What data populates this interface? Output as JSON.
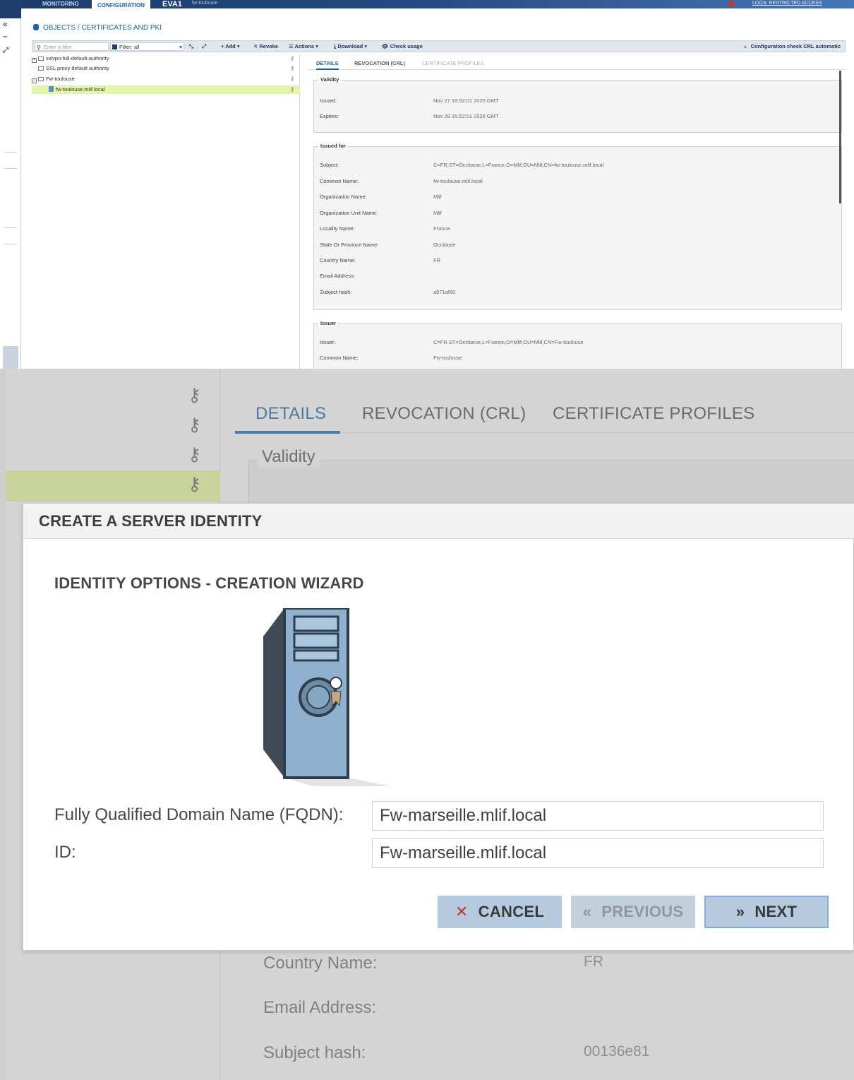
{
  "top": {
    "nav_tabs": [
      "MONITORING",
      "CONFIGURATION"
    ],
    "active_tab": "CONFIGURATION",
    "firewall_label": "EVA1",
    "firewall_name": "fw-toulouse",
    "logs_link": "LOGS: RESTRICTED ACCESS",
    "breadcrumb": "OBJECTS / CERTIFICATES AND PKI",
    "toolbar": {
      "filter_placeholder": "Enter a filter",
      "filter_select": "Filter: all",
      "add": "+ Add ▾",
      "revoke": "✕ Revoke",
      "actions": "☰ Actions ▾",
      "download": "⤓ Download ▾",
      "check_usage": "👁 Check usage",
      "warning": "Configuration check CRL automatic"
    },
    "tree": [
      {
        "label": "sslvpn-full-default-authority",
        "type": "ca-collapsed"
      },
      {
        "label": "SSL proxy default authority",
        "type": "ca"
      },
      {
        "label": "Fw-toulouse",
        "type": "ca-expanded"
      },
      {
        "label": "fw-toulouse.mlif.local",
        "type": "cert",
        "selected": true
      }
    ],
    "detail_tabs": [
      "DETAILS",
      "REVOCATION (CRL)",
      "CERTIFICATE PROFILES"
    ],
    "validity": {
      "legend": "Validity",
      "issued_label": "Issued:",
      "issued": "Nov 27 16:52:01 2025 GMT",
      "expires_label": "Expires:",
      "expires": "Nov 28 16:52:01 2026 GMT"
    },
    "issued_for": {
      "legend": "Issued for",
      "rows": [
        {
          "k": "Subject:",
          "v": "C=FR,ST=Occitanie,L=France,O=Mlif,OU=Mlif,CN=fw-toulouse.mlif.local"
        },
        {
          "k": "Common Name:",
          "v": "fw-toulouse.mlif.local"
        },
        {
          "k": "Organization Name:",
          "v": "Mlif"
        },
        {
          "k": "Organization Unit Name:",
          "v": "Mlif"
        },
        {
          "k": "Locality Name:",
          "v": "France"
        },
        {
          "k": "State Or Province Name:",
          "v": "Occitanie"
        },
        {
          "k": "Country Name:",
          "v": "FR"
        },
        {
          "k": "Email Address:",
          "v": ""
        },
        {
          "k": "Subject hash:",
          "v": "a971af60"
        }
      ]
    },
    "issuer": {
      "legend": "Issuer",
      "rows": [
        {
          "k": "Issuer:",
          "v": "C=FR,ST=Occitanie,L=France,O=Mlif,OU=Mlif,CN=Fw-toulouse"
        },
        {
          "k": "Common Name:",
          "v": "Fw-toulouse"
        }
      ]
    }
  },
  "zoom": {
    "detail_tabs": [
      "DETAILS",
      "REVOCATION (CRL)",
      "CERTIFICATE PROFILES"
    ],
    "validity_legend": "Validity",
    "bg_rows": [
      {
        "k": "Country Name:",
        "v": "FR"
      },
      {
        "k": "Email Address:",
        "v": ""
      },
      {
        "k": "Subject hash:",
        "v": "00136e81"
      }
    ],
    "modal": {
      "title": "CREATE A SERVER IDENTITY",
      "subtitle": "IDENTITY OPTIONS - CREATION WIZARD",
      "fqdn_label": "Fully Qualified Domain Name (FQDN):",
      "fqdn_value": "Fw-marseille.mlif.local",
      "id_label": "ID:",
      "id_value": "Fw-marseille.mlif.local",
      "cancel": "CANCEL",
      "previous": "PREVIOUS",
      "next": "NEXT"
    }
  },
  "colors": {
    "accent": "#1a5fb4",
    "selected_row": "#e2f5a9",
    "button": "#b5cade",
    "cancel_icon": "#c0392b"
  }
}
